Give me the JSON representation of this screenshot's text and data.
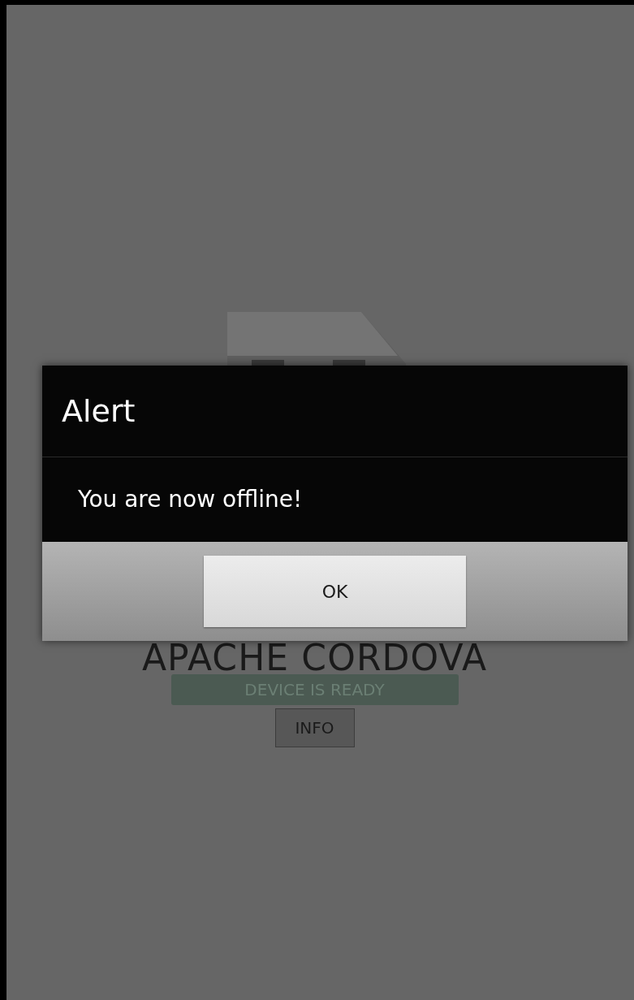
{
  "app": {
    "title": "APACHE CORDOVA",
    "status": "DEVICE IS READY",
    "info_button": "INFO"
  },
  "dialog": {
    "title": "Alert",
    "message": "You are now offline!",
    "buttons": [
      "OK"
    ]
  }
}
